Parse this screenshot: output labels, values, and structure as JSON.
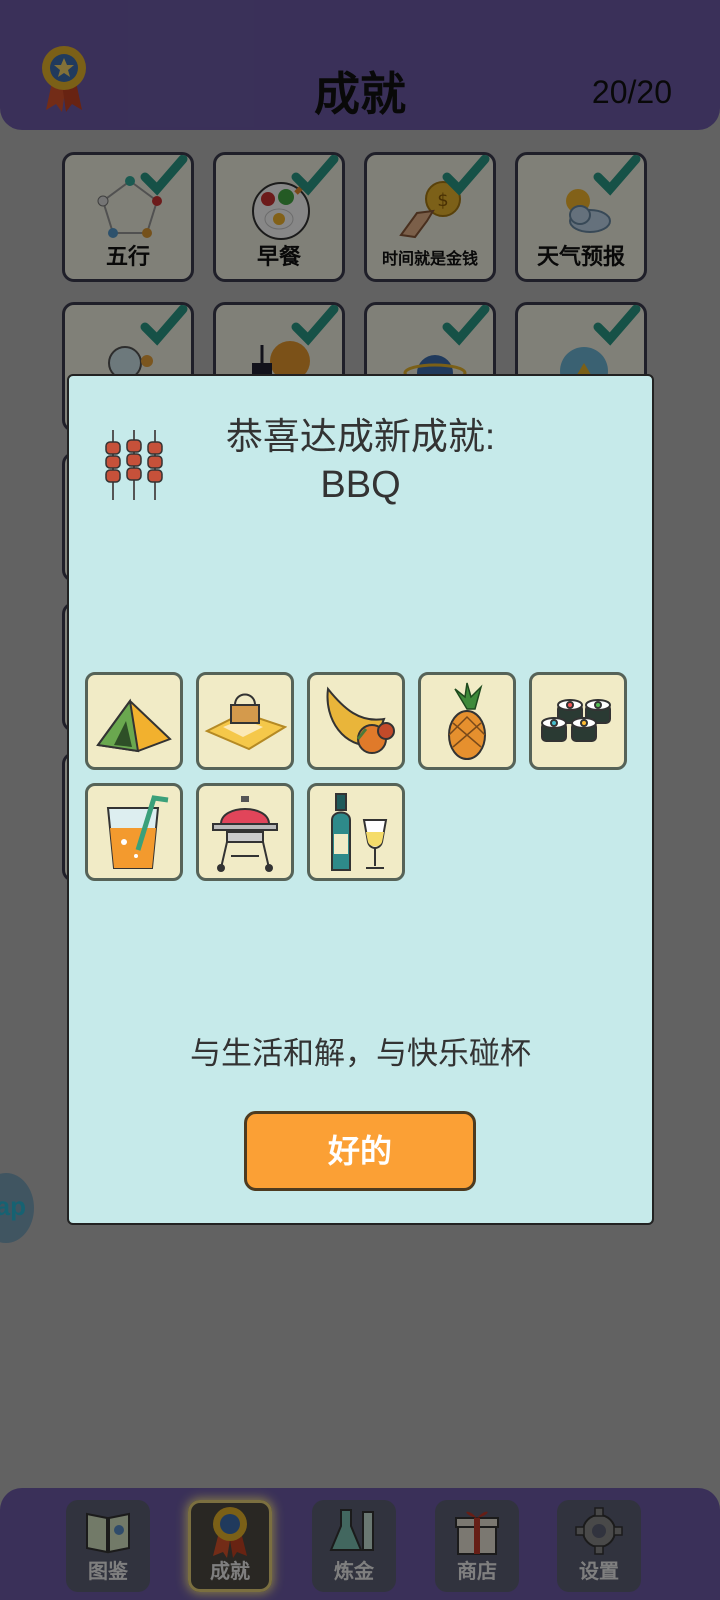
{
  "header": {
    "title": "成就",
    "count": "20/20"
  },
  "achievements": [
    {
      "label": "五行",
      "completed": true
    },
    {
      "label": "早餐",
      "completed": true
    },
    {
      "label": "时间就是金钱",
      "completed": true
    },
    {
      "label": "天气预报",
      "completed": true
    }
  ],
  "floating_button": {
    "label": "ap"
  },
  "modal": {
    "title": "恭喜达成新成就:",
    "achievement_name": "BBQ",
    "items": [
      "tent-icon",
      "picnic-basket-icon",
      "cornucopia-icon",
      "pineapple-icon",
      "sushi-icon",
      "juice-icon",
      "grill-icon",
      "wine-icon"
    ],
    "motto": "与生活和解，与快乐碰杯",
    "ok_label": "好的"
  },
  "tabs": [
    {
      "label": "图鉴",
      "icon": "book-icon"
    },
    {
      "label": "成就",
      "icon": "medal-icon",
      "active": true
    },
    {
      "label": "炼金",
      "icon": "flask-icon"
    },
    {
      "label": "商店",
      "icon": "gift-icon"
    },
    {
      "label": "设置",
      "icon": "gear-icon"
    }
  ],
  "colors": {
    "header": "#6e5ca8",
    "modal_bg": "#c6eaea",
    "ok_button": "#fba035",
    "check": "#2a9a86"
  }
}
